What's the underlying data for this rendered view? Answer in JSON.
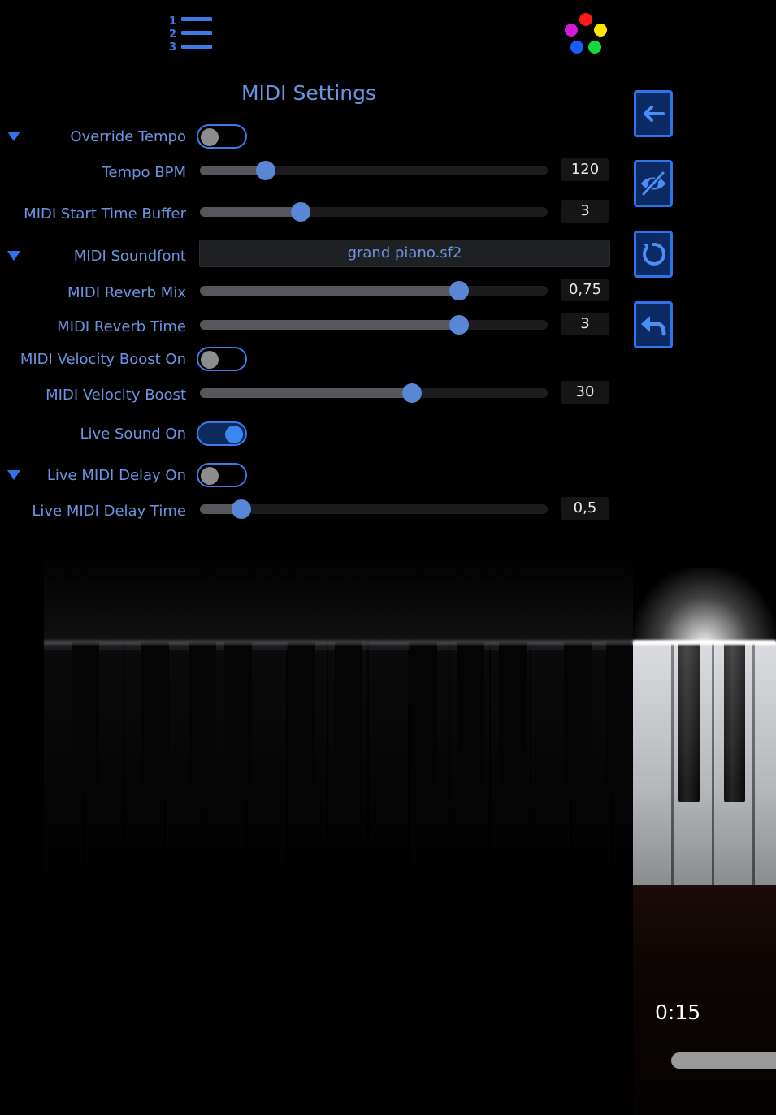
{
  "title": "MIDI Settings",
  "colors": {
    "accent": "#2f72ea",
    "label": "#6b95e0",
    "dot_red": "#ff1a1a",
    "dot_yellow": "#ffe600",
    "dot_magenta": "#d21bd8",
    "dot_blue": "#1a5cff",
    "dot_green": "#16d83d"
  },
  "top_bar": {
    "playlist_numbers": [
      "1",
      "2",
      "3"
    ]
  },
  "settings": {
    "override_tempo": {
      "label": "Override Tempo",
      "on": false
    },
    "tempo_bpm": {
      "label": "Tempo BPM",
      "value": "120",
      "fraction": 0.19
    },
    "midi_start_time_buffer": {
      "label": "MIDI Start Time Buffer",
      "value": "3",
      "fraction": 0.29
    },
    "midi_soundfont": {
      "label": "MIDI Soundfont",
      "value": "grand piano.sf2"
    },
    "midi_reverb_mix": {
      "label": "MIDI Reverb Mix",
      "value": "0,75",
      "fraction": 0.745
    },
    "midi_reverb_time": {
      "label": "MIDI Reverb Time",
      "value": "3",
      "fraction": 0.745
    },
    "midi_velocity_boost_on": {
      "label": "MIDI Velocity Boost On",
      "on": false
    },
    "midi_velocity_boost": {
      "label": "MIDI Velocity Boost",
      "value": "30",
      "fraction": 0.61
    },
    "live_sound_on": {
      "label": "Live Sound On",
      "on": true
    },
    "live_midi_delay_on": {
      "label": "Live MIDI Delay On",
      "on": false
    },
    "live_midi_delay_time": {
      "label": "Live MIDI Delay Time",
      "value": "0,5",
      "fraction": 0.12
    }
  },
  "side_buttons": [
    "back-arrow-icon",
    "hide-eye-icon",
    "reset-icon",
    "undo-icon"
  ],
  "player": {
    "time": "0:15"
  }
}
